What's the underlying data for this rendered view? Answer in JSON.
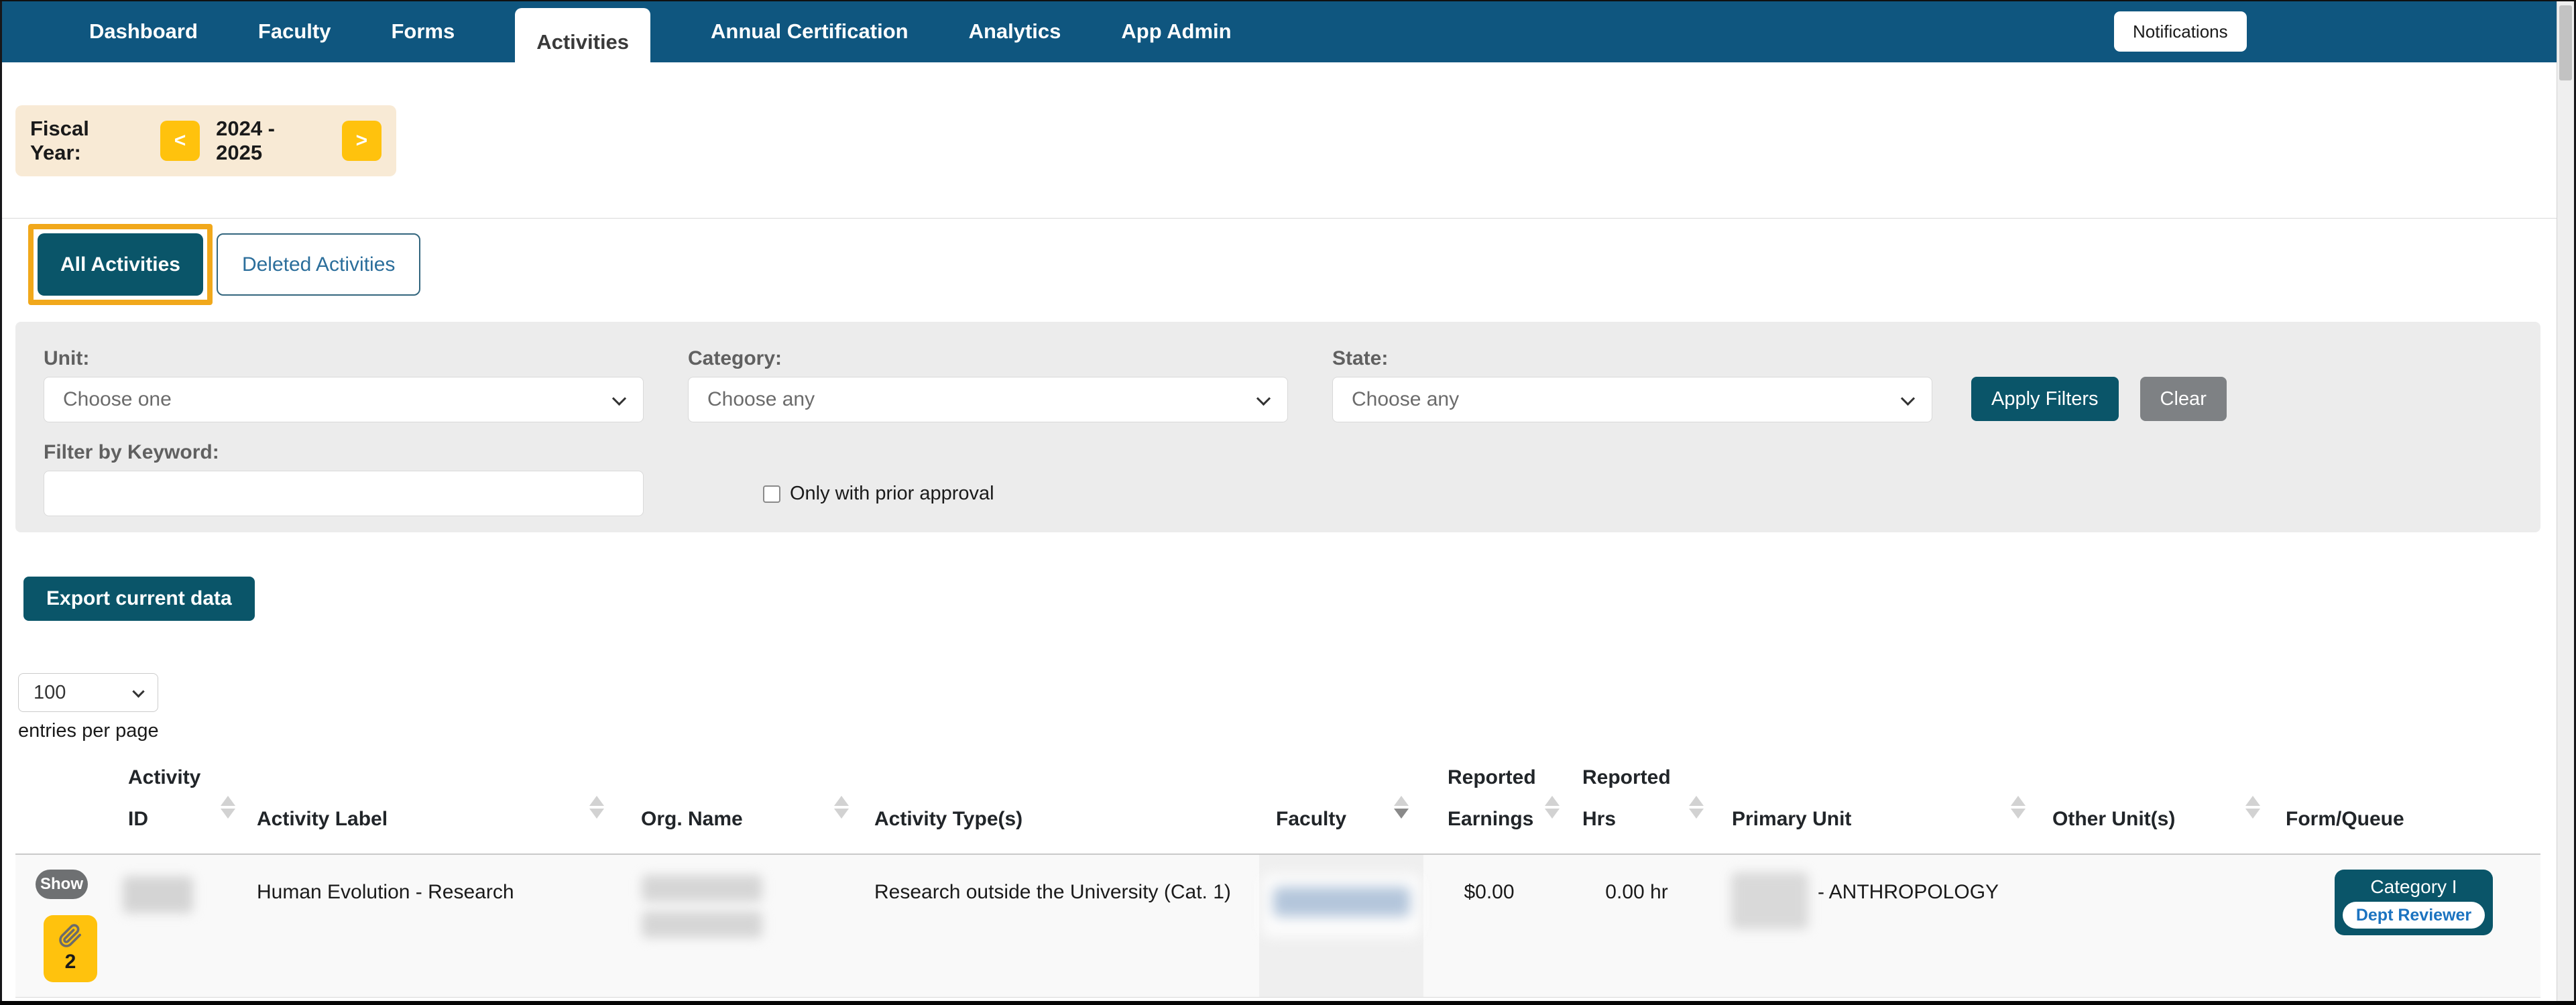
{
  "nav": {
    "items": [
      {
        "label": "Dashboard",
        "active": false
      },
      {
        "label": "Faculty",
        "active": false
      },
      {
        "label": "Forms",
        "active": false
      },
      {
        "label": "Activities",
        "active": true
      },
      {
        "label": "Annual Certification",
        "active": false
      },
      {
        "label": "Analytics",
        "active": false
      },
      {
        "label": "App Admin",
        "active": false
      }
    ],
    "notifications_label": "Notifications"
  },
  "fiscal_year": {
    "label": "Fiscal Year:",
    "value": "2024 - 2025",
    "prev": "<",
    "next": ">"
  },
  "view_tabs": {
    "all": "All Activities",
    "deleted": "Deleted Activities"
  },
  "filters": {
    "unit": {
      "label": "Unit:",
      "value": "Choose one"
    },
    "category": {
      "label": "Category:",
      "value": "Choose any"
    },
    "state": {
      "label": "State:",
      "value": "Choose any"
    },
    "keyword": {
      "label": "Filter by Keyword:",
      "value": ""
    },
    "prior_approval_label": "Only with prior approval",
    "apply_label": "Apply Filters",
    "clear_label": "Clear"
  },
  "export_label": "Export current data",
  "pagination": {
    "page_size": "100",
    "entries_label": "entries per page"
  },
  "table": {
    "columns": [
      {
        "label": "",
        "sortable": false
      },
      {
        "label": "Activity ID",
        "sortable": true
      },
      {
        "label": "Activity Label",
        "sortable": true
      },
      {
        "label": "Org. Name",
        "sortable": true
      },
      {
        "label": "Activity Type(s)",
        "sortable": false
      },
      {
        "label": "Faculty",
        "sortable": true,
        "sorted": "desc"
      },
      {
        "label": "Reported Earnings",
        "sortable": true
      },
      {
        "label": "Reported Hrs",
        "sortable": true
      },
      {
        "label": "Primary Unit",
        "sortable": true
      },
      {
        "label": "Other Unit(s)",
        "sortable": true
      },
      {
        "label": "Form/Queue",
        "sortable": false
      }
    ],
    "row": {
      "show_label": "Show",
      "attachments_count": "2",
      "activity_id_redacted": true,
      "activity_label": "Human Evolution - Research",
      "org_name_redacted": true,
      "activity_types": "Research outside the University (Cat. 1)",
      "faculty_redacted": true,
      "reported_earnings": "$0.00",
      "reported_hrs": "0.00 hr",
      "primary_unit_code_redacted": true,
      "primary_unit_suffix": "- ANTHROPOLOGY",
      "other_units": "",
      "form_queue": {
        "category": "Category I",
        "queue": "Dept Reviewer"
      }
    }
  },
  "colors": {
    "nav_blue": "#0F567F",
    "teal": "#0A5569",
    "yellow": "#FFC20D",
    "highlight_orange": "#F1A81B",
    "fiscal_cream": "#F8EAD5",
    "filter_gray": "#ECECEC",
    "link_blue": "#1B73C0",
    "row_bg": "#F9F9F9",
    "faculty_band": "#EFEFEF"
  }
}
